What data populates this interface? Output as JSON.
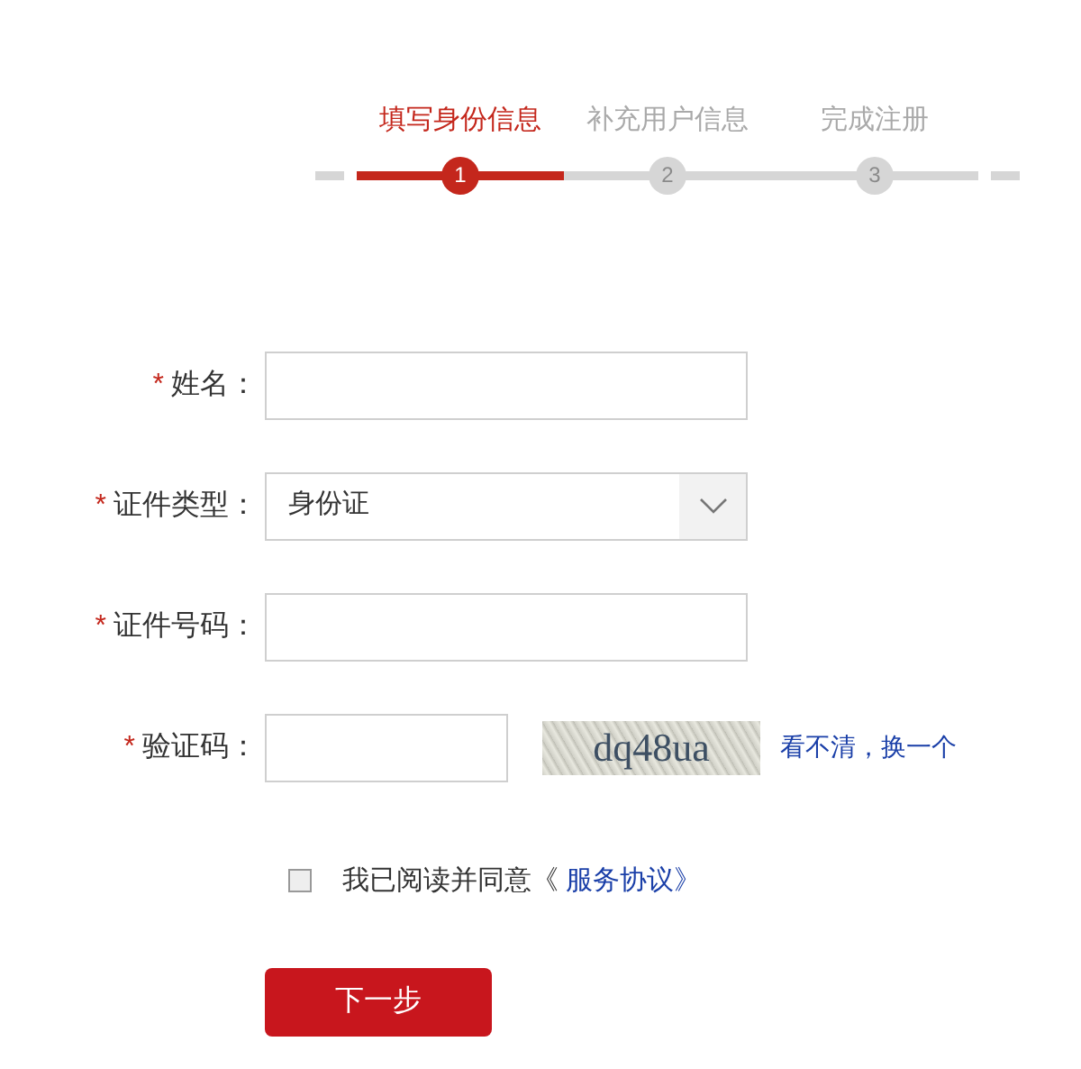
{
  "steps": [
    {
      "label": "填写身份信息",
      "number": "1",
      "selected": true
    },
    {
      "label": "补充用户信息",
      "number": "2",
      "selected": false
    },
    {
      "label": "完成注册",
      "number": "3",
      "selected": false
    }
  ],
  "fields": [
    {
      "kind": "text",
      "marker": "*",
      "label": "姓名："
    },
    {
      "kind": "select",
      "marker": "*",
      "label": "证件类型：",
      "value": "身份证"
    },
    {
      "kind": "text",
      "marker": "*",
      "label": "证件号码："
    },
    {
      "kind": "captcha",
      "marker": "*",
      "label": "验证码：",
      "captcha_text": "dq48ua",
      "refresh_link": "看不清，换一个"
    }
  ],
  "agreement": {
    "checked": false,
    "text": "我已阅读并同意《",
    "link": "服务协议》"
  },
  "next_button": "下一步"
}
